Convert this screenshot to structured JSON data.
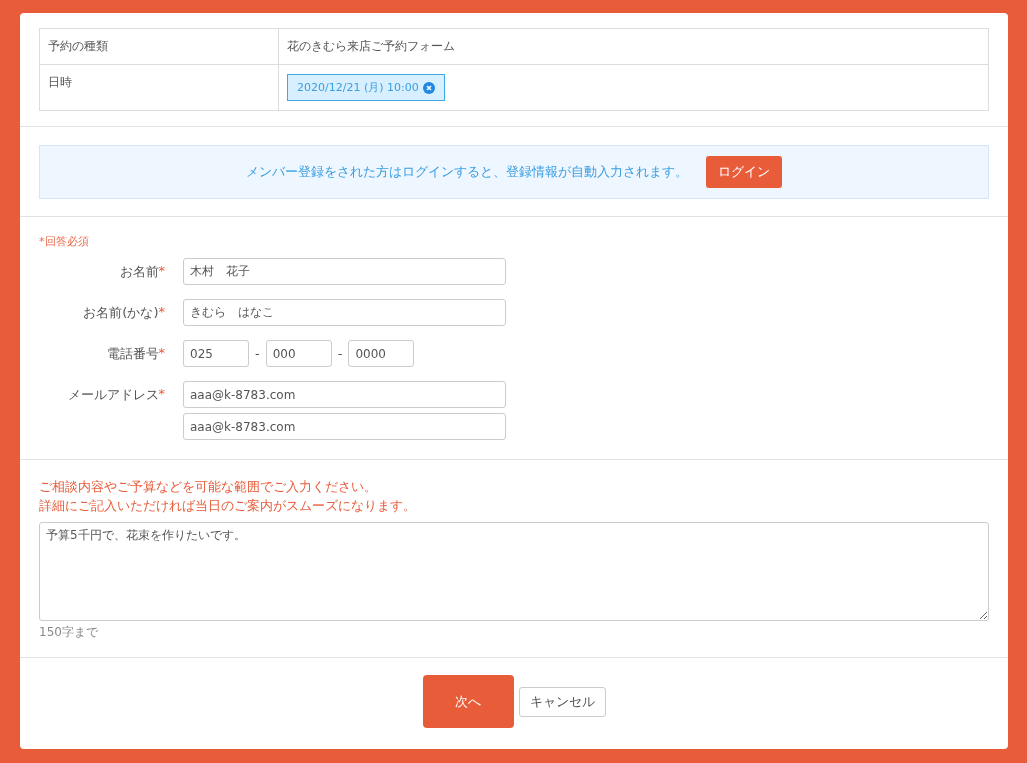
{
  "reservation": {
    "rows": [
      {
        "label": "予約の種類",
        "kind": "text",
        "value": "花のきむら来店ご予約フォーム"
      },
      {
        "label": "日時",
        "kind": "chip",
        "value": "2020/12/21 (月) 10:00"
      }
    ]
  },
  "login_notice": {
    "text": "メンバー登録をされた方はログインすると、登録情報が自動入力されます。",
    "button": "ログイン"
  },
  "form": {
    "required_note": "*回答必須",
    "required_mark": "*",
    "fields": [
      {
        "label": "お名前",
        "required": true,
        "kind": "text",
        "values": [
          "木村　花子"
        ]
      },
      {
        "label": "お名前(かな)",
        "required": true,
        "kind": "text",
        "values": [
          "きむら　はなこ"
        ]
      },
      {
        "label": "電話番号",
        "required": true,
        "kind": "phone",
        "values": [
          "025",
          "000",
          "0000"
        ],
        "separator": "-"
      },
      {
        "label": "メールアドレス",
        "required": true,
        "kind": "email",
        "values": [
          "aaa@k-8783.com",
          "aaa@k-8783.com"
        ]
      }
    ]
  },
  "consultation": {
    "hint_lines": [
      "ご相談内容やご予算などを可能な範囲でご入力ください。",
      "詳細にご記入いただければ当日のご案内がスムーズになります。"
    ],
    "value": "予算5千円で、花束を作りたいです。",
    "limit": "150字まで"
  },
  "buttons": [
    {
      "label": "次へ",
      "kind": "primary"
    },
    {
      "label": "キャンセル",
      "kind": "secondary"
    }
  ]
}
